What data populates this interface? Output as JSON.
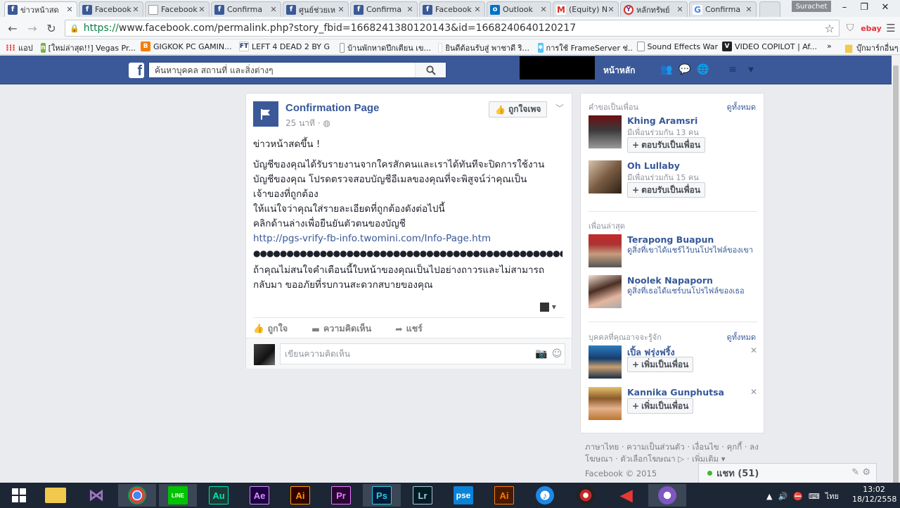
{
  "browser": {
    "tabs": [
      {
        "label": "ข่าวหน้าสด",
        "icon": "facebook-icon"
      },
      {
        "label": "Facebook",
        "icon": "facebook-icon"
      },
      {
        "label": "Facebook",
        "icon": "page-icon"
      },
      {
        "label": "Confirma",
        "icon": "facebook-icon"
      },
      {
        "label": "ศูนย์ช่วยเห",
        "icon": "facebook-icon"
      },
      {
        "label": "Confirma",
        "icon": "facebook-icon"
      },
      {
        "label": "Facebook",
        "icon": "facebook-icon"
      },
      {
        "label": "Outlook",
        "icon": "outlook-icon"
      },
      {
        "label": "(Equity) N",
        "icon": "gmail-icon"
      },
      {
        "label": "หลักทรัพย์",
        "icon": "y-icon"
      },
      {
        "label": "Confirma",
        "icon": "google-icon"
      }
    ],
    "user": "Surachet",
    "url_scheme": "https://",
    "url_rest": "www.facebook.com/permalink.php?story_fbid=1668241380120143&id=1668240640120217",
    "extensions": [
      "ebay"
    ]
  },
  "bookmarks": [
    {
      "label": "แอป",
      "icon": "apps-icon"
    },
    {
      "label": "[ใหม่ล่าสุด!!] Vegas Pr...",
      "icon": "new-badge-icon"
    },
    {
      "label": "GIGKOK PC GAMIN...",
      "icon": "blogger-icon"
    },
    {
      "label": "LEFT 4 DEAD 2 BY G...",
      "icon": "ft-icon"
    },
    {
      "label": "บ้านพักหาดปึกเตียน เข...",
      "icon": "page-icon"
    },
    {
      "label": "ยินดีต้อนรับสู่ พาชาดี ริ...",
      "icon": "page-icon"
    },
    {
      "label": "การใช้ FrameServer ช่...",
      "icon": "frameserver-icon"
    },
    {
      "label": "Sound Effects War",
      "icon": "page-icon"
    },
    {
      "label": "VIDEO COPILOT | Af...",
      "icon": "videocopilot-icon"
    },
    {
      "label": "»",
      "icon": ""
    },
    {
      "label": "บุ๊กมาร์กอื่นๆ",
      "icon": "folder-icon"
    }
  ],
  "fb": {
    "search_placeholder": "ค้นหาบุคคล สถานที่ และสิ่งต่างๆ",
    "home": "หน้าหลัก"
  },
  "post": {
    "page_name": "Confirmation Page",
    "time": "25 นาที",
    "like_page": "ถูกใจเพจ",
    "lines": [
      "ข่าวหน้าสดขึ้น !",
      "บัญชีของคุณได้รับรายงานจากใครสักคนและเราได้ทันทีจะปิดการใช้งาน",
      "บัญชีของคุณ โปรดตรวจสอบบัญชีอีเมลของคุณที่จะพิสูจน์ว่าคุณเป็น",
      "เจ้าของที่ถูกต้อง",
      "ให้แน่ใจว่าคุณใส่รายละเอียดที่ถูกต้องดังต่อไปนี้",
      "คลิกด้านล่างเพื่อยืนยันตัวตนของบัญชี"
    ],
    "link": "http://pgs-vrify-fb-info.twomini.com/Info-Page.htm",
    "dots": "●●●●●●●●●●●●●●●●●●●●●●●●●●●●●●●●●●●●●●●●●●●●●●●●●●●●●●●●●●●",
    "warning_lines": [
      "ถ้าคุณไม่สนใจคำเตือนนี้ใบหน้าของคุณเป็นไปอย่างถาวรและไม่สามารถ",
      "กลับมา ขออภัยที่รบกวนสะดวกสบายของคุณ"
    ],
    "actions": {
      "like": "ถูกใจ",
      "comment": "ความคิดเห็น",
      "share": "แชร์"
    },
    "comment_placeholder": "เขียนความคิดเห็น"
  },
  "sidebar": {
    "friend_requests": {
      "title": "คำขอเป็นเพื่อน",
      "see_all": "ดูทั้งหมด",
      "people": [
        {
          "name": "Khing Aramsri",
          "mutual": "มีเพื่อนร่วมกัน 13 คน",
          "button": "ตอบรับเป็นเพื่อน"
        },
        {
          "name": "Oh Lullaby",
          "mutual": "มีเพื่อนร่วมกัน 15 คน",
          "button": "ตอบรับเป็นเพื่อน"
        }
      ]
    },
    "recent_friends": {
      "title": "เพื่อนล่าสุด",
      "people": [
        {
          "name": "Terapong Buapun",
          "desc": "ดูสิ่งที่เขาได้แชร์ไว้บนโปรไฟล์ของเขา"
        },
        {
          "name": "Noolek Napaporn",
          "desc": "ดูสิ่งที่เธอได้แชร์บนโปรไฟล์ของเธอ"
        }
      ]
    },
    "people_you_may_know": {
      "title": "บุคคลที่คุณอาจจะรู้จัก",
      "see_all": "ดูทั้งหมด",
      "people": [
        {
          "name": "เปิ้ล ฟรุ่งฟริ้ง",
          "button": "เพิ่มเป็นเพื่อน"
        },
        {
          "name": "Kannika Gunphutsa",
          "button": "เพิ่มเป็นเพื่อน"
        }
      ]
    }
  },
  "footer": {
    "links": "ภาษาไทย · ความเป็นส่วนตัว · เงื่อนไข · คุกกี้ · ลงโฆษณา · ตัวเลือกโฆษณา ▷ · เพิ่มเติม ▾",
    "copyright": "Facebook © 2015"
  },
  "chat": {
    "label": "แชท (51)"
  },
  "taskbar": {
    "apps": [
      "start",
      "file-explorer",
      "visual-studio",
      "chrome",
      "line",
      "audition",
      "after-effects",
      "illustrator",
      "premiere",
      "photoshop",
      "lightroom",
      "pse",
      "illustrator-2",
      "itunes",
      "app-red",
      "app-vector",
      "app-circle"
    ],
    "app_labels": {
      "audition": "Au",
      "after-effects": "Ae",
      "illustrator": "Ai",
      "premiere": "Pr",
      "photoshop": "Ps",
      "lightroom": "Lr",
      "pse": "pse",
      "illustrator-2": "Ai",
      "line": "LINE"
    },
    "lang": "ไทย",
    "time": "13:02",
    "date": "18/12/2558"
  },
  "colors": {
    "fb_blue": "#3b5998",
    "link": "#365899",
    "taskbar": "#1c2634"
  }
}
